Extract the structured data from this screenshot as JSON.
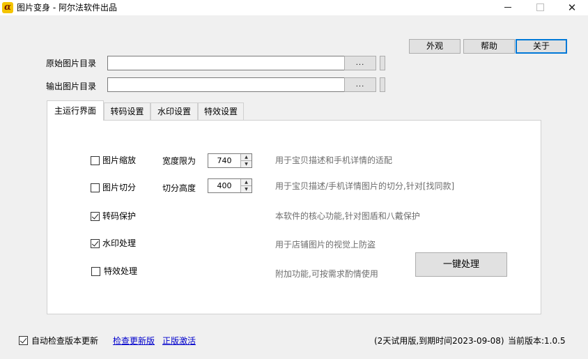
{
  "window": {
    "title": "图片变身 - 阿尔法软件出品",
    "icon_glyph": "α",
    "close_glyph": "✕"
  },
  "toolbar": {
    "appearance_label": "外观",
    "help_label": "帮助",
    "about_label": "关于"
  },
  "directories": {
    "source_label": "原始图片目录",
    "source_value": "",
    "output_label": "输出图片目录",
    "output_value": "",
    "browse_label": "..."
  },
  "tabs": [
    {
      "label": "主运行界面",
      "active": true
    },
    {
      "label": "转码设置",
      "active": false
    },
    {
      "label": "水印设置",
      "active": false
    },
    {
      "label": "特效设置",
      "active": false
    }
  ],
  "options": [
    {
      "label": "图片缩放",
      "checked": false,
      "field_label": "宽度限为",
      "field_value": "740",
      "description": "用于宝贝描述和手机详情的适配"
    },
    {
      "label": "图片切分",
      "checked": false,
      "field_label": "切分高度",
      "field_value": "400",
      "description": "用于宝贝描述/手机详情图片的切分,针对[找同款]"
    },
    {
      "label": "转码保护",
      "checked": true,
      "description": "本软件的核心功能,针对图盾和八戴保护"
    },
    {
      "label": "水印处理",
      "checked": true,
      "description": "用于店铺图片的视觉上防盗"
    },
    {
      "label": "特效处理",
      "checked": false,
      "description": "附加功能,可按需求酌情使用"
    }
  ],
  "process_button_label": "一键处理",
  "footer": {
    "auto_check_label": "自动检查版本更新",
    "auto_check_checked": true,
    "check_update_link": "检查更新版",
    "activate_link": "正版激活",
    "trial_status": "(2天试用版,到期时间2023-09-08)",
    "version_label": "当前版本:1.0.5"
  },
  "colors": {
    "accent": "#0078d7",
    "link": "#0000cc",
    "description_text": "#6d6d6d",
    "icon_bg": "#f4c400"
  }
}
